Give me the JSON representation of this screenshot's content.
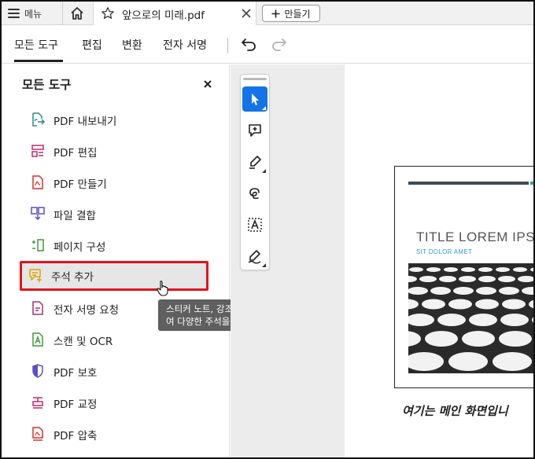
{
  "tabbar": {
    "menu_label": "메뉴",
    "active_tab_title": "앞으로의 미래.pdf",
    "new_tab_label": "만들기"
  },
  "toolbar": {
    "tabs": [
      "모든 도구",
      "편집",
      "변환",
      "전자 서명"
    ]
  },
  "panel": {
    "title": "모든 도구",
    "items": [
      {
        "label": "PDF 내보내기",
        "icon": "export-pdf-icon",
        "color": "#2d8a8a"
      },
      {
        "label": "PDF 편집",
        "icon": "edit-pdf-icon",
        "color": "#c02a6e"
      },
      {
        "label": "PDF 만들기",
        "icon": "create-pdf-icon",
        "color": "#d6312a"
      },
      {
        "label": "파일 결합",
        "icon": "combine-files-icon",
        "color": "#5b4fc4"
      },
      {
        "label": "페이지 구성",
        "icon": "organize-pages-icon",
        "color": "#3f9a3a"
      },
      {
        "label": "주석 추가",
        "icon": "add-comment-icon",
        "color": "#e0a100"
      },
      {
        "label": "전자 서명 요청",
        "icon": "request-esign-icon",
        "color": "#a0307a"
      },
      {
        "label": "스캔 및 OCR",
        "icon": "scan-ocr-icon",
        "color": "#3f9a3a"
      },
      {
        "label": "PDF 보호",
        "icon": "protect-pdf-icon",
        "color": "#5b4fc4"
      },
      {
        "label": "PDF 교정",
        "icon": "redact-pdf-icon",
        "color": "#c02a6e"
      },
      {
        "label": "PDF 압축",
        "icon": "compress-pdf-icon",
        "color": "#d6312a"
      }
    ]
  },
  "tooltip": {
    "line1": "스티커 노트, 강조 표시를 비롯하",
    "line2": "여 다양한 주석을 추가합니다."
  },
  "document": {
    "slide_title": "TITLE LOREM IPSU",
    "slide_subtitle": "SIT DOLOR AMET",
    "caption": "여기는 메인 화면입니"
  },
  "colors": {
    "accent": "#1473e6",
    "highlight_border": "#e1141c"
  }
}
